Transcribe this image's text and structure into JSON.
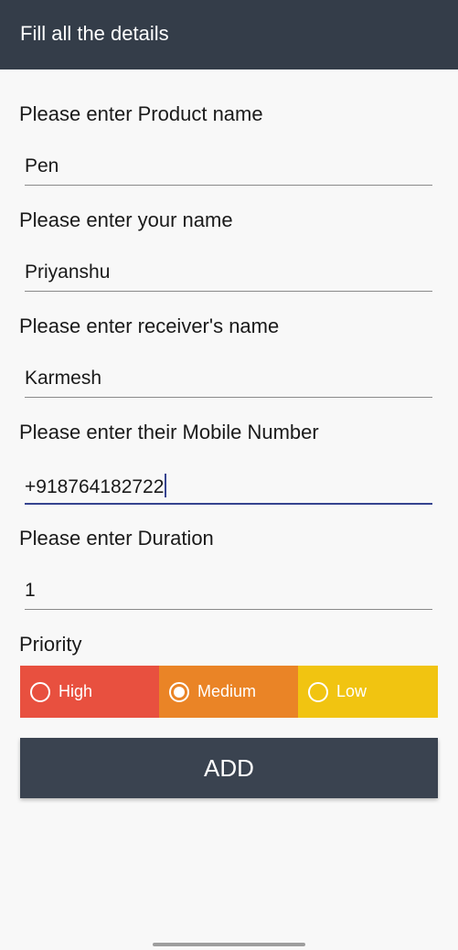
{
  "app_bar": {
    "title": "Fill all the details",
    "background": "#343d49"
  },
  "fields": [
    {
      "label": "Please enter Product name",
      "value": "Pen"
    },
    {
      "label": "Please enter your name",
      "value": "Priyanshu"
    },
    {
      "label": "Please enter receiver's name",
      "value": "Karmesh"
    },
    {
      "label": "Please enter their Mobile Number",
      "value": "+918764182722",
      "focused": true
    },
    {
      "label": "Please enter Duration",
      "value": "1"
    }
  ],
  "priority": {
    "label": "Priority",
    "selected": "Medium",
    "options": [
      {
        "label": "High",
        "color": "#e8503f",
        "checked": false
      },
      {
        "label": "Medium",
        "color": "#ea8426",
        "checked": true
      },
      {
        "label": "Low",
        "color": "#f1c411",
        "checked": false
      }
    ]
  },
  "add_button": {
    "label": "ADD",
    "color": "#3a4350"
  },
  "accent_color": "#36448f"
}
